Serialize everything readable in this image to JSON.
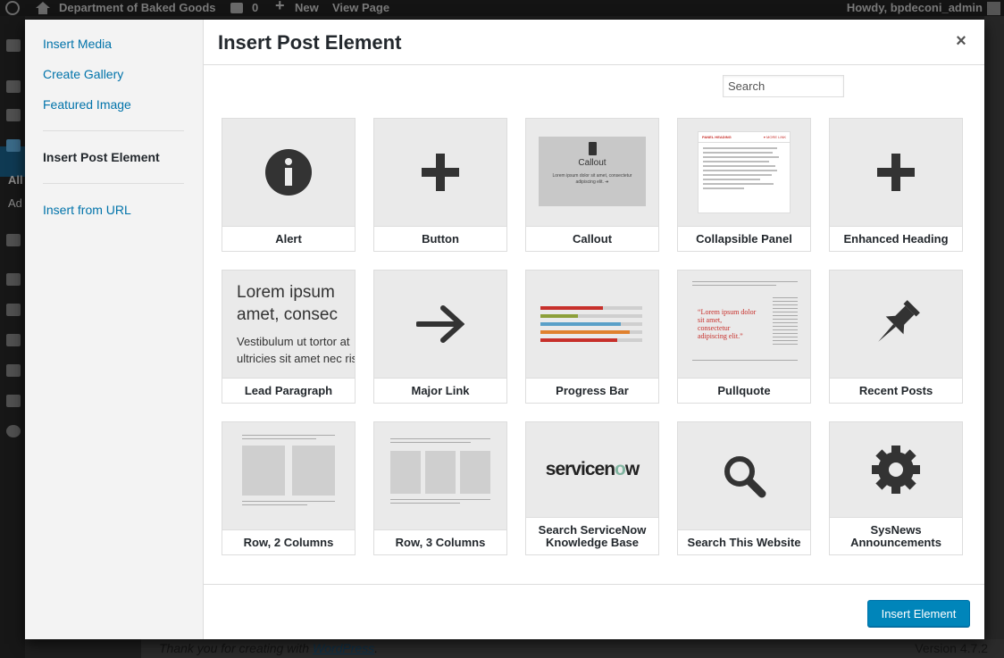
{
  "adminbar": {
    "site_name": "Department of Baked Goods",
    "comments_count": "0",
    "new_label": "New",
    "view_label": "View Page",
    "howdy": "Howdy, bpdeconi_admin"
  },
  "background": {
    "sidebar_text_1": "All",
    "sidebar_text_2": "Ad",
    "footer_prefix": "Thank you for creating with ",
    "footer_link": "WordPress",
    "footer_suffix": ".",
    "version": "Version 4.7.2"
  },
  "menu": {
    "items": [
      {
        "label": "Insert Media"
      },
      {
        "label": "Create Gallery"
      },
      {
        "label": "Featured Image"
      },
      {
        "label": "Insert Post Element"
      },
      {
        "label": "Insert from URL"
      }
    ]
  },
  "modal": {
    "title": "Insert Post Element",
    "close_icon": "×",
    "search_placeholder": "Search",
    "insert_button": "Insert Element"
  },
  "elements": [
    {
      "label": "Alert",
      "icon": "info-circle-icon"
    },
    {
      "label": "Button",
      "icon": "plus-icon"
    },
    {
      "label": "Callout",
      "icon": "callout-preview",
      "preview_title": "Callout",
      "preview_text_1": "Lorem ipsum dolor sit amet, consectetur",
      "preview_text_2": "adipiscing elit.  ➜"
    },
    {
      "label": "Collapsible Panel",
      "icon": "panel-preview",
      "preview_heading": "PANEL HEADING",
      "preview_link": "▾ MORE LINK"
    },
    {
      "label": "Enhanced Heading",
      "icon": "plus-icon"
    },
    {
      "label": "Lead Paragraph",
      "icon": "lead-preview",
      "preview_big_1": "Lorem ipsum",
      "preview_big_2": "amet, consec",
      "preview_small_1": "Vestibulum ut tortor at",
      "preview_small_2": "ultricies sit amet nec ris"
    },
    {
      "label": "Major Link",
      "icon": "arrow-right-icon"
    },
    {
      "label": "Progress Bar",
      "icon": "progress-preview"
    },
    {
      "label": "Pullquote",
      "icon": "pullquote-preview",
      "preview_quote_1": "“Lorem ipsum dolor",
      "preview_quote_2": "sit amet,",
      "preview_quote_3": "consectetur",
      "preview_quote_4": "adipiscing elit.”"
    },
    {
      "label": "Recent Posts",
      "icon": "pushpin-icon"
    },
    {
      "label": "Row, 2 Columns",
      "icon": "two-column-preview"
    },
    {
      "label": "Row, 3 Columns",
      "icon": "three-column-preview"
    },
    {
      "label": "Search ServiceNow Knowledge Base",
      "label_line1": "Search ServiceNow",
      "label_line2": "Knowledge Base",
      "icon": "servicenow-logo",
      "logo_text_1": "servicen",
      "logo_text_2": "w"
    },
    {
      "label": "Search This Website",
      "icon": "magnifier-icon"
    },
    {
      "label": "SysNews Announcements",
      "label_line1": "SysNews",
      "label_line2": "Announcements",
      "icon": "gear-icon"
    }
  ],
  "colors": {
    "accent": "#0085ba",
    "link": "#0073aa",
    "icon_dark": "#333333",
    "servicenow_green": "#81b5a1"
  }
}
